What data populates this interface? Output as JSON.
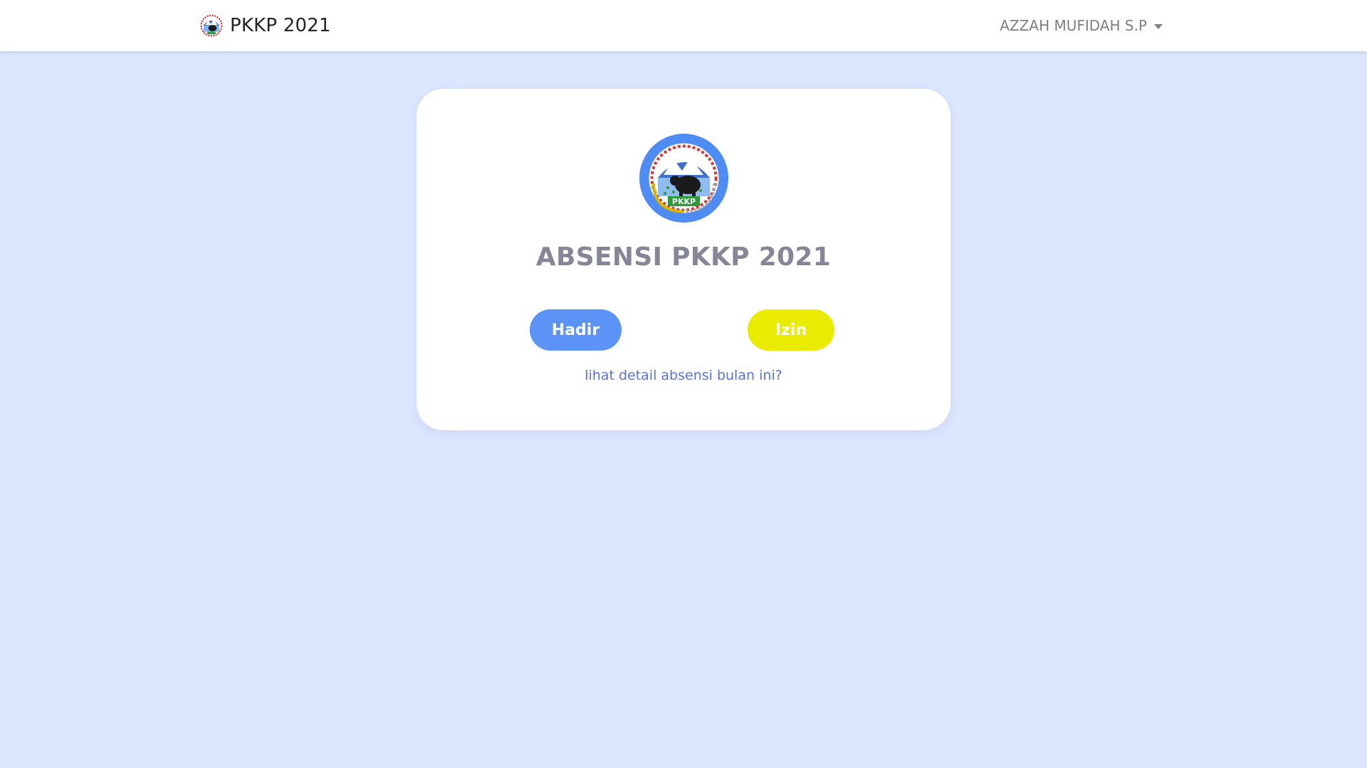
{
  "navbar": {
    "brand_text": "PKKP 2021",
    "user_name": "AZZAH MUFIDAH S.P"
  },
  "card": {
    "title": "ABSENSI PKKP 2021",
    "logo_text": "PKKP",
    "hadir_label": "Hadir",
    "izin_label": "Izin",
    "detail_link": "lihat detail absensi bulan ini?"
  },
  "colors": {
    "background": "#dce6fd",
    "hadir_button": "#5c93f6",
    "izin_button": "#e9ec00",
    "link": "#5873d8",
    "title": "#858796"
  }
}
